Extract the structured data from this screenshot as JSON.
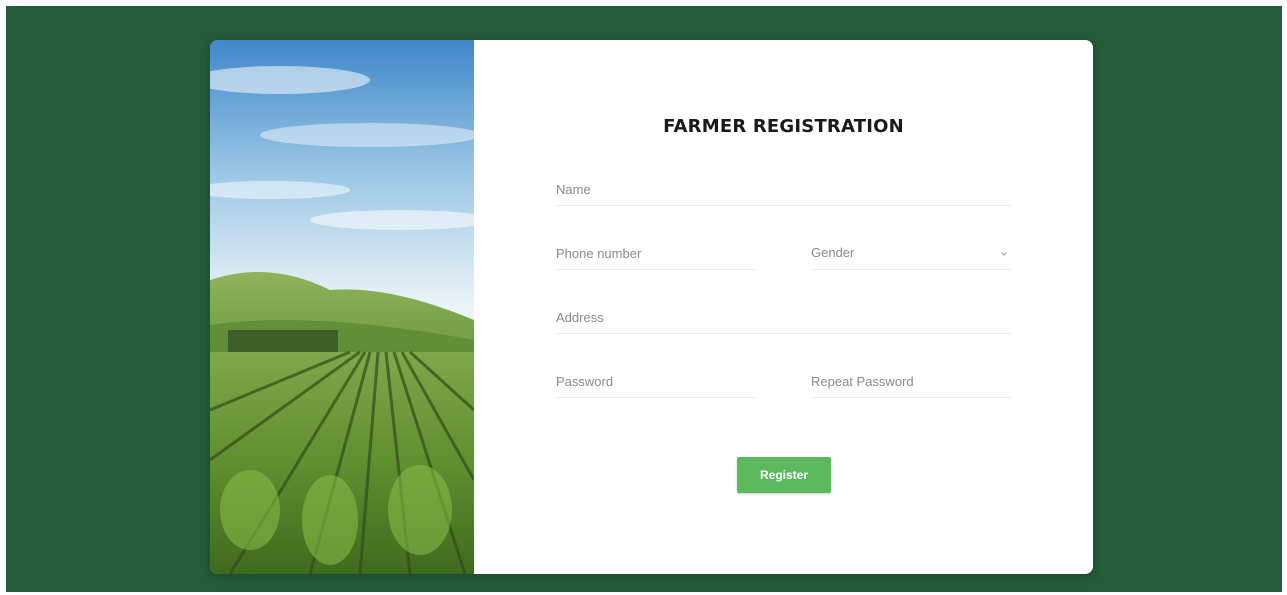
{
  "colors": {
    "page_background": "#245c3b",
    "card_background": "#ffffff",
    "button": "#5cb85c"
  },
  "form": {
    "title": "FARMER REGISTRATION",
    "name_placeholder": "Name",
    "phone_placeholder": "Phone number",
    "gender_select": {
      "selected": "Gender",
      "icon": "chevron-down-icon"
    },
    "address_placeholder": "Address",
    "password_placeholder": "Password",
    "repeat_password_placeholder": "Repeat Password",
    "register_label": "Register"
  },
  "hero_image": {
    "subject": "vineyard-field-image"
  }
}
